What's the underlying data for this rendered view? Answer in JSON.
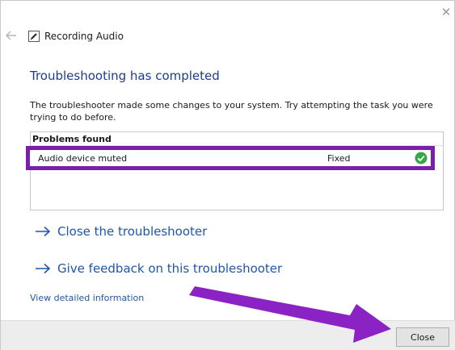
{
  "window": {
    "title": "Recording Audio",
    "close_glyph": "✕"
  },
  "icons": {
    "back": "back-arrow-icon",
    "title": "pen-icon",
    "check": "check-circle-icon",
    "link_arrow": "arrow-right-icon"
  },
  "main": {
    "heading": "Troubleshooting has completed",
    "description": "The troubleshooter made some changes to your system. Try attempting the task you were trying to do before."
  },
  "problems": {
    "header": "Problems found",
    "items": [
      {
        "name": "Audio device muted",
        "status": "Fixed"
      }
    ]
  },
  "links": {
    "close_troubleshooter": "Close the troubleshooter",
    "give_feedback": "Give feedback on this troubleshooter",
    "view_details": "View detailed information"
  },
  "footer": {
    "close_label": "Close"
  },
  "colors": {
    "heading": "#1c3d8c",
    "link": "#1f56a8",
    "highlight": "#7a1fa8",
    "check": "#3aa64a"
  }
}
